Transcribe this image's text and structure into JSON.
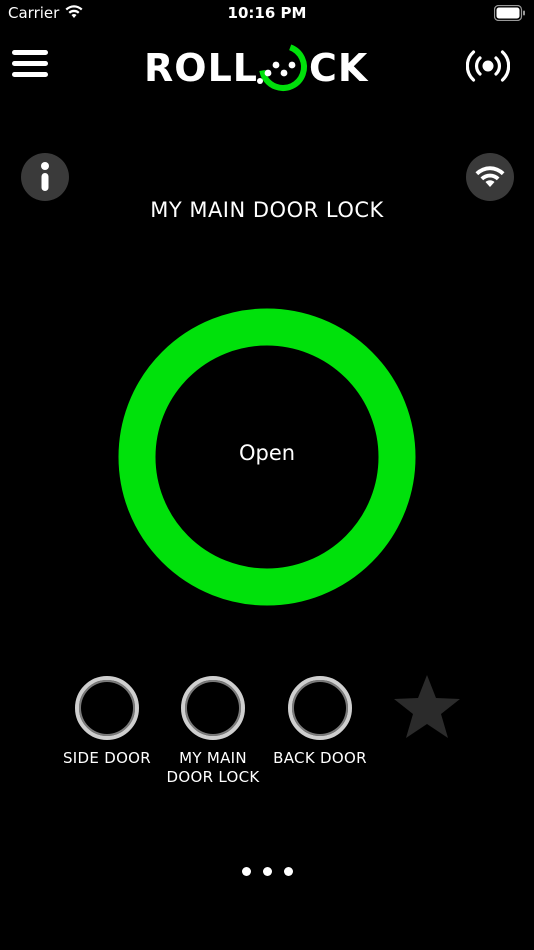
{
  "status_bar": {
    "carrier": "Carrier",
    "time": "10:16 PM"
  },
  "header": {
    "logo_text_left": "ROLL",
    "logo_text_right": "CK",
    "menu_icon": "hamburger-menu-icon",
    "broadcast_icon": "broadcast-signal-icon"
  },
  "toolbar": {
    "info_icon": "info-icon",
    "wifi_icon": "wifi-icon"
  },
  "lock": {
    "name": "MY MAIN DOOR LOCK",
    "state": "Open",
    "ring_color": "#00e10b"
  },
  "locks": [
    {
      "label": "SIDE DOOR"
    },
    {
      "label": "MY MAIN DOOR LOCK"
    },
    {
      "label": "BACK DOOR"
    }
  ],
  "favorite": {
    "icon": "star-icon"
  },
  "pagination": {
    "dots": 3
  },
  "colors": {
    "background": "#000000",
    "accent_green": "#00e10b",
    "button_gray": "#3a3a3a"
  }
}
